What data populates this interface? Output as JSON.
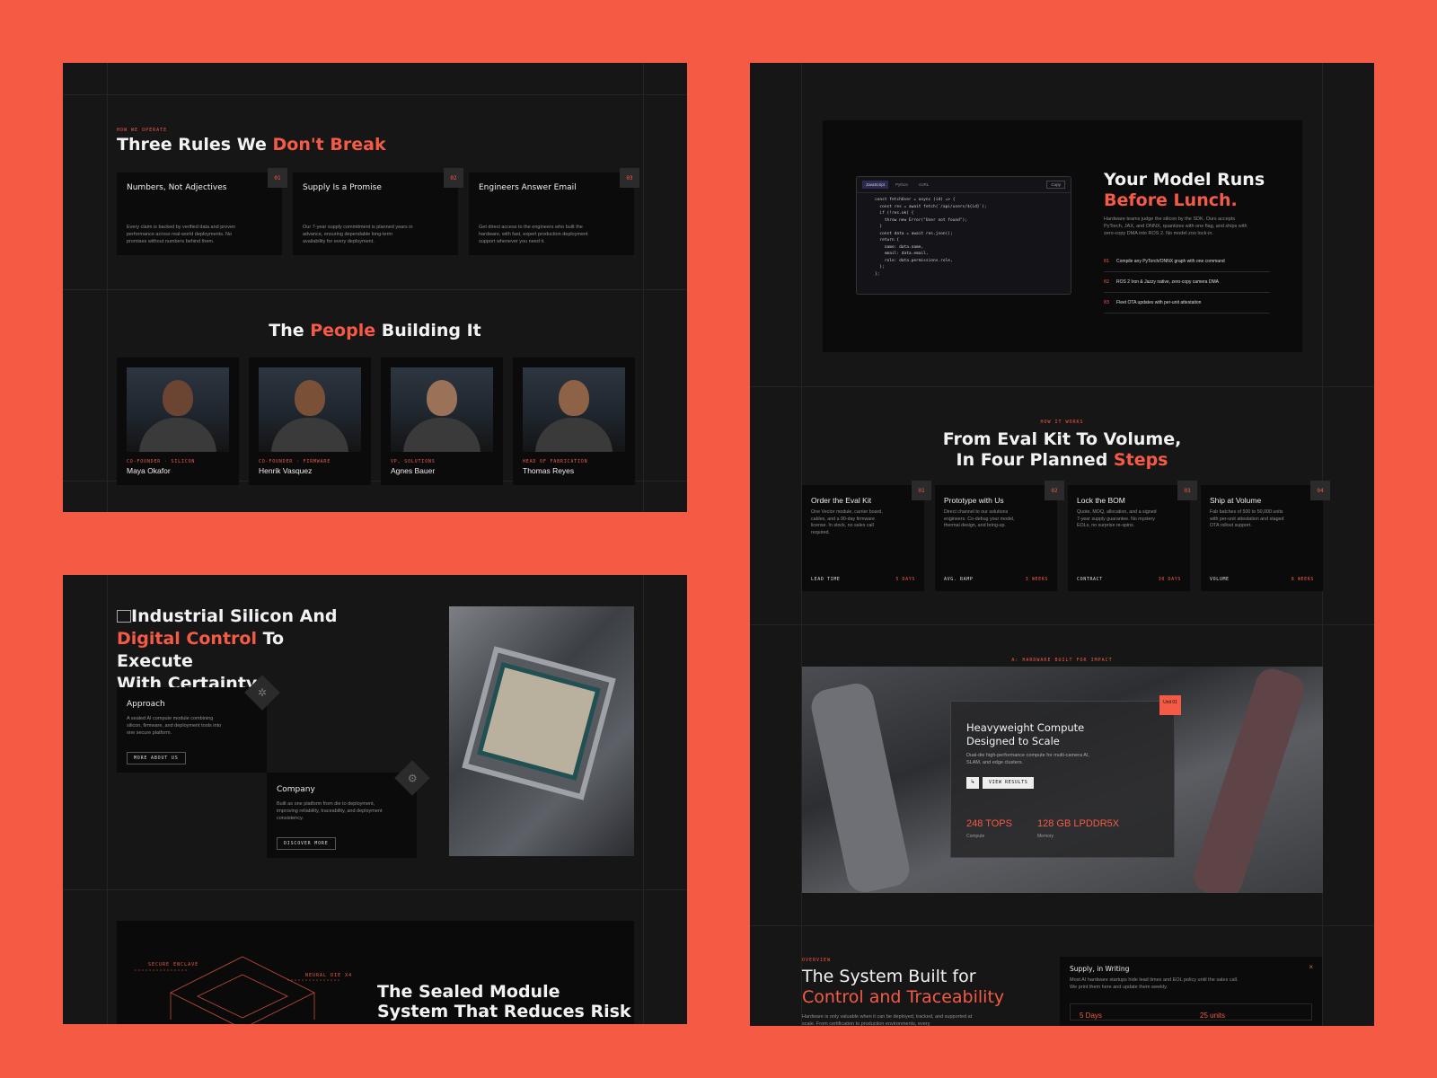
{
  "rules_section": {
    "eyebrow": "HOW WE OPERATE",
    "title_pre": "Three Rules We ",
    "title_accent": "Don't Break",
    "rules": [
      {
        "num": "01",
        "title": "Numbers, Not Adjectives",
        "text": "Every claim is backed by verified data and proven performance across real-world deployments. No promises without numbers behind them."
      },
      {
        "num": "02",
        "title": "Supply Is a Promise",
        "text": "Our 7-year supply commitment is planned years in advance, ensuring dependable long-term availability for every deployment."
      },
      {
        "num": "03",
        "title": "Engineers Answer Email",
        "text": "Get direct access to the engineers who built the hardware, with fast, expert production deployment support whenever you need it."
      }
    ]
  },
  "people_section": {
    "title_pre": "The ",
    "title_accent": "People",
    "title_post": " Building It",
    "people": [
      {
        "role": "CO-FOUNDER · SILICON",
        "name": "Maya Okafor"
      },
      {
        "role": "CO-FOUNDER · FIRMWARE",
        "name": "Henrik Vasquez"
      },
      {
        "role": "VP, SOLUTIONS",
        "name": "Agnes Bauer"
      },
      {
        "role": "HEAD OF FABRICATION",
        "name": "Thomas Reyes"
      }
    ]
  },
  "industrial_section": {
    "title_line1": "Industrial Silicon And",
    "title_accent": "Digital Control",
    "title_line2_post": " To Execute",
    "title_line3": "With Certainty",
    "approach": {
      "title": "Approach",
      "text": "A sealed AI compute module combining silicon, firmware, and deployment tools into one secure platform.",
      "button": "MORE ABOUT US"
    },
    "company": {
      "title": "Company",
      "text": "Built as one platform from die to deployment, improving reliability, traceability, and deployment consistency.",
      "button": "DISCOVER MORE"
    }
  },
  "sealed_section": {
    "title_line1": "The Sealed Module",
    "title_line2": "System That Reduces Risk",
    "label1": "SECURE ENCLAVE",
    "label2": "NEURAL DIE x4"
  },
  "model_section": {
    "tabs": [
      "JavaScript",
      "Python",
      "cURL"
    ],
    "copy_label": "Copy",
    "code_lines": [
      "const fetchUser = async (id) => {",
      "  const res = await fetch(`/api/users/${id}`);",
      "",
      "  if (!res.ok) {",
      "    throw new Error(\"User not found\");",
      "  }",
      "",
      "  const data = await res.json();",
      "  return {",
      "    name: data.name,",
      "    email: data.email,",
      "    role: data.permissions.role,",
      "  };",
      "};"
    ],
    "title_line1": "Your Model Runs",
    "title_accent": "Before Lunch.",
    "text": "Hardware teams judge the silicon by the SDK. Ours accepts PyTorch, JAX, and ONNX, quantizes with one flag, and ships with zero-copy DMA into ROS 2. No model zoo lock-in.",
    "features": [
      {
        "num": "01",
        "text": "Compile any PyTorch/ONNX graph with one command"
      },
      {
        "num": "02",
        "text": "ROS 2 Iron & Jazzy native, zero-copy camera DMA"
      },
      {
        "num": "03",
        "text": "Fleet OTA updates with per-unit attestation"
      }
    ]
  },
  "steps_section": {
    "eyebrow": "HOW IT WORKS",
    "title_line1": "From Eval Kit To Volume,",
    "title_line2_pre": "In Four Planned ",
    "title_accent": "Steps",
    "steps": [
      {
        "num": "01",
        "title": "Order the Eval Kit",
        "desc": "One Vector module, carrier board, cables, and a 90-day firmware license. In stock, no sales call required.",
        "metric_label": "LEAD TIME",
        "metric_value": "5 DAYS"
      },
      {
        "num": "02",
        "title": "Prototype with Us",
        "desc": "Direct channel to our solutions engineers. Co-debug your model, thermal design, and bring-up.",
        "metric_label": "AVG. RAMP",
        "metric_value": "3 WEEKS"
      },
      {
        "num": "03",
        "title": "Lock the BOM",
        "desc": "Quote, MOQ, allocation, and a signed 7-year supply guarantee. No mystery EOLs, no surprise re-spins.",
        "metric_label": "CONTRACT",
        "metric_value": "30 DAYS"
      },
      {
        "num": "04",
        "title": "Ship at Volume",
        "desc": "Fab batches of 500 to 50,000 units with per-unit attestation and staged OTA rollout support.",
        "metric_label": "VOLUME",
        "metric_value": "8 WEEKS"
      }
    ]
  },
  "hardware_section": {
    "eyebrow": "A: HARDWARE BUILT FOR IMPACT",
    "unit_badge": "Unit 01",
    "title_line1": "Heavyweight Compute",
    "title_line2": "Designed to Scale",
    "text": "Dual-die high-performance compute for multi-camera AI, SLAM, and edge clusters.",
    "button": "VIEW RESULTS",
    "stats": [
      {
        "value": "248 TOPS",
        "label": "Compute"
      },
      {
        "value": "128 GB LPDDR5X",
        "label": "Memory"
      }
    ]
  },
  "overview_section": {
    "eyebrow": "OVERVIEW",
    "title_line1": "The System Built for",
    "title_accent": "Control and Traceability",
    "text": "Hardware is only valuable when it can be deployed, tracked, and supported at scale. From certification to production environments, every",
    "supply_card": {
      "title": "Supply, in Writing",
      "text": "Most AI hardware startups hide lead times and EOL policy until the sales call. We print them here and update them weekly.",
      "stats": [
        "5 Days",
        "25 units"
      ]
    }
  },
  "colors": {
    "accent": "#f55a45",
    "panel": "#161616",
    "card": "#0b0b0b"
  }
}
